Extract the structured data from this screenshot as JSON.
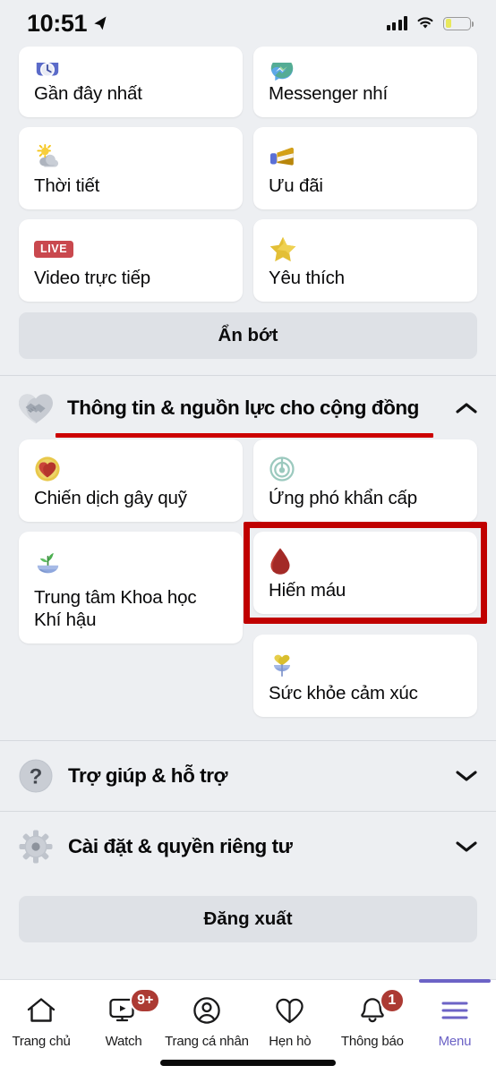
{
  "status_bar": {
    "time": "10:51",
    "location_icon": "location-arrow-icon",
    "signal_icon": "cellular-signal-icon",
    "wifi_icon": "wifi-icon",
    "battery_icon": "battery-low-power-icon",
    "battery_level_percent": 26
  },
  "shortcuts_grid": [
    {
      "label": "Gần đây nhất",
      "icon": "recent-clock-icon",
      "glyph": "🕘",
      "clipped_top": true
    },
    {
      "label": "Messenger nhí",
      "icon": "messenger-kids-icon",
      "glyph": "💬",
      "clipped_top": true
    },
    {
      "label": "Thời tiết",
      "icon": "weather-sun-cloud-icon",
      "glyph": "⛅",
      "clipped_top": false
    },
    {
      "label": "Ưu đãi",
      "icon": "offers-megaphone-icon",
      "glyph": "📣",
      "clipped_top": false
    },
    {
      "label": "Video trực tiếp",
      "icon": "live-video-badge-icon",
      "glyph": "LIVE",
      "clipped_top": false
    },
    {
      "label": "Yêu thích",
      "icon": "favorites-star-icon",
      "glyph": "⭐",
      "clipped_top": false
    }
  ],
  "see_less_button": {
    "label": "Ẩn bớt"
  },
  "community_section": {
    "title": "Thông tin & nguồn lực cho cộng đồng",
    "icon": "handshake-heart-icon",
    "chevron": "chevron-up-icon",
    "expanded": true,
    "annotation_underline_color": "#CC0000",
    "left_column": [
      {
        "label": "Chiến dịch gây quỹ",
        "icon": "fundraiser-heart-icon",
        "glyph": "🧡",
        "tall": false
      },
      {
        "label": "Trung tâm Khoa học Khí hậu",
        "icon": "climate-science-center-icon",
        "glyph": "🌱",
        "tall": true
      }
    ],
    "right_column": [
      {
        "label": "Ứng phó khẩn cấp",
        "icon": "crisis-response-icon",
        "glyph": "🎯",
        "tall": false
      },
      {
        "label": "Hiến máu",
        "icon": "blood-donation-drop-icon",
        "glyph": "🩸",
        "tall": false,
        "highlighted": true
      },
      {
        "label": "Sức khỏe cảm xúc",
        "icon": "emotional-health-icon",
        "glyph": "💛",
        "tall": false
      }
    ],
    "highlight_color": "#C00000"
  },
  "menu_rows": [
    {
      "label": "Trợ giúp & hỗ trợ",
      "icon": "help-question-icon",
      "chevron": "chevron-down-icon"
    },
    {
      "label": "Cài đặt & quyền riêng tư",
      "icon": "settings-gear-icon",
      "chevron": "chevron-down-icon"
    }
  ],
  "logout_button": {
    "label": "Đăng xuất"
  },
  "bottom_nav": {
    "active_color": "#6C63C6",
    "badge_color": "#AC3A33",
    "tabs": [
      {
        "label": "Trang chủ",
        "icon": "home-icon",
        "badge": "",
        "active": false
      },
      {
        "label": "Watch",
        "icon": "watch-video-icon",
        "badge": "9+",
        "active": false
      },
      {
        "label": "Trang cá nhân",
        "icon": "profile-person-icon",
        "badge": "",
        "active": false
      },
      {
        "label": "Hẹn hò",
        "icon": "dating-heart-icon",
        "badge": "",
        "active": false
      },
      {
        "label": "Thông báo",
        "icon": "notifications-bell-icon",
        "badge": "1",
        "active": false
      },
      {
        "label": "Menu",
        "icon": "hamburger-menu-icon",
        "badge": "",
        "active": true
      }
    ]
  }
}
